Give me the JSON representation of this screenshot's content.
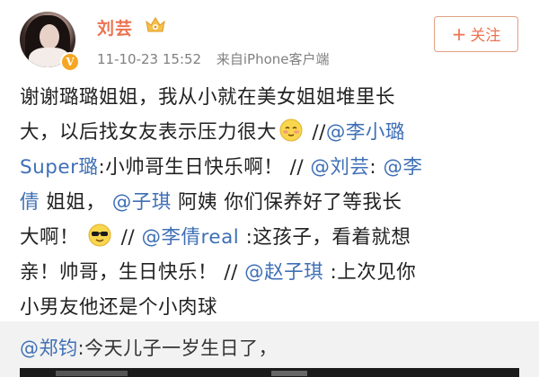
{
  "post": {
    "author": "刘芸",
    "timestamp": "11-10-23 15:52",
    "source": "来自iPhone客户端",
    "follow_label": "关注",
    "follow_plus": "+",
    "lines": [
      {
        "segments": [
          {
            "text": "谢谢璐璐姐姐，我从小就在美女姐姐堆里长",
            "type": "text"
          }
        ]
      },
      {
        "segments": [
          {
            "text": "大，以后找女友表示压力很大",
            "type": "text"
          },
          {
            "emoji": "blush-emoji",
            "type": "emoji"
          },
          {
            "text": " //",
            "type": "text"
          },
          {
            "text": "@李小璐",
            "type": "mention"
          }
        ]
      },
      {
        "segments": [
          {
            "text": "Super璐",
            "type": "mention"
          },
          {
            "text": ":小帅哥生日快乐啊！ // ",
            "type": "text"
          },
          {
            "text": "@刘芸",
            "type": "mention"
          },
          {
            "text": ": ",
            "type": "text"
          },
          {
            "text": "@李",
            "type": "mention"
          }
        ]
      },
      {
        "segments": [
          {
            "text": "倩",
            "type": "mention"
          },
          {
            "text": " 姐姐， ",
            "type": "text"
          },
          {
            "text": "@子琪",
            "type": "mention"
          },
          {
            "text": " 阿姨 你们保养好了等我长",
            "type": "text"
          }
        ]
      },
      {
        "segments": [
          {
            "text": "大啊！ ",
            "type": "text"
          },
          {
            "emoji": "cool-sunglasses-emoji",
            "type": "emoji"
          },
          {
            "text": "  // ",
            "type": "text"
          },
          {
            "text": "@李倩real",
            "type": "mention"
          },
          {
            "text": " :这孩子，看着就想",
            "type": "text"
          }
        ]
      },
      {
        "segments": [
          {
            "text": "亲！帅哥，生日快乐！  // ",
            "type": "text"
          },
          {
            "text": "@赵子琪",
            "type": "mention"
          },
          {
            "text": " :上次见你",
            "type": "text"
          }
        ]
      },
      {
        "segments": [
          {
            "text": "小男友他还是个小肉球",
            "type": "text"
          }
        ]
      }
    ]
  },
  "repost": {
    "mention": "@郑钧",
    "text": ":今天儿子一岁生日了，"
  },
  "colors": {
    "username": "#eb7350",
    "mention": "#3f70b5",
    "meta": "#808080",
    "repost_bg": "#f2f2f2"
  },
  "icons": {
    "verify": "verified-v-icon",
    "vip": "vip-crown-icon"
  }
}
